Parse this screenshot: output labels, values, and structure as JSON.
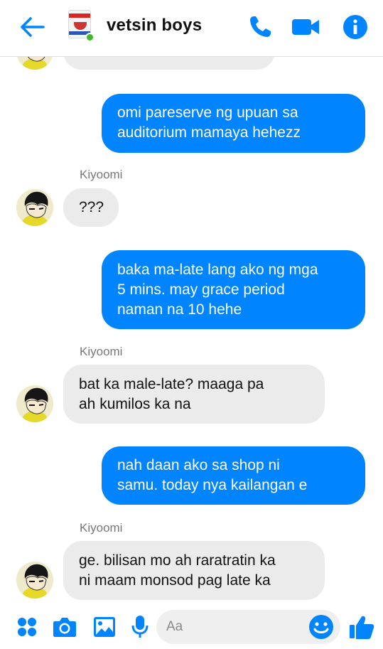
{
  "header": {
    "title": "vetsin boys",
    "group_avatar_icon": "seasoning-can-icon",
    "online_status": "online",
    "accent_color": "#0084ff"
  },
  "messages": [
    {
      "type": "partial-incoming",
      "text": ""
    },
    {
      "type": "outgoing",
      "lines": [
        "omi pareserve ng upuan sa",
        "auditorium mamaya hehezz"
      ]
    },
    {
      "type": "sender-name",
      "text": "Kiyoomi"
    },
    {
      "type": "incoming",
      "lines": [
        "???"
      ]
    },
    {
      "type": "outgoing",
      "lines": [
        "baka ma-late lang ako ng mga",
        "5 mins. may grace period",
        "naman na 10 hehe"
      ]
    },
    {
      "type": "sender-name",
      "text": "Kiyoomi"
    },
    {
      "type": "incoming",
      "lines": [
        "bat ka male-late? maaga pa",
        "ah kumilos ka na"
      ]
    },
    {
      "type": "outgoing",
      "lines": [
        "nah daan ako sa shop ni",
        "samu. today nya kailangan e"
      ]
    },
    {
      "type": "sender-name",
      "text": "Kiyoomi"
    },
    {
      "type": "incoming",
      "lines": [
        "ge. bilisan mo ah raratratin ka",
        "ni maam monsod pag late ka"
      ]
    }
  ],
  "composer": {
    "placeholder": "Aa",
    "value": ""
  },
  "colors": {
    "outgoing_bubble": "#0084ff",
    "incoming_bubble": "#ebebeb",
    "icon_blue": "#0084ff"
  }
}
